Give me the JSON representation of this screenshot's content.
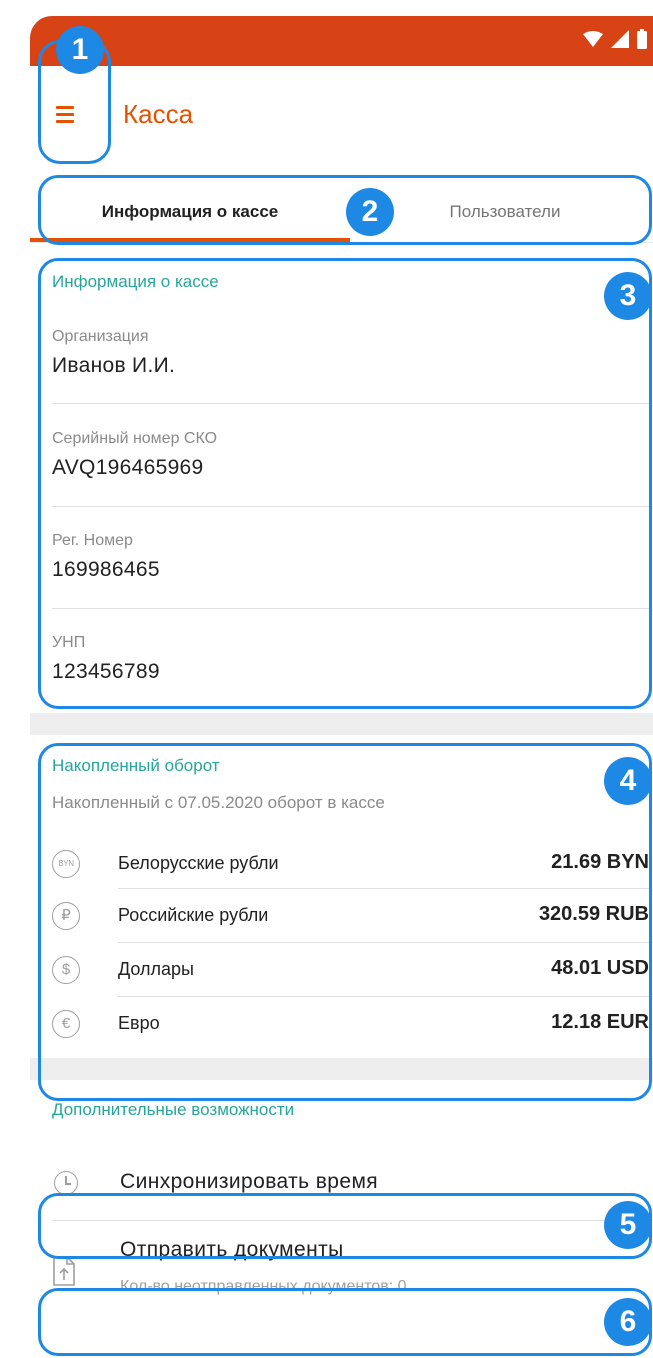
{
  "app_bar": {
    "title": "Касса"
  },
  "tabs": [
    {
      "label": "Информация о кассе",
      "active": true
    },
    {
      "label": "Пользователи",
      "active": false
    }
  ],
  "info": {
    "section_title": "Информация о кассе",
    "fields": [
      {
        "label": "Организация",
        "value": "Иванов И.И."
      },
      {
        "label": "Серийный номер СКО",
        "value": "AVQ196465969"
      },
      {
        "label": "Рег. Номер",
        "value": "169986465"
      },
      {
        "label": "УНП",
        "value": "123456789"
      }
    ]
  },
  "turnover": {
    "section_title": "Накопленный оборот",
    "subtitle": "Накопленный с 07.05.2020 оборот в кассе",
    "rows": [
      {
        "icon_text": "BYN",
        "icon": "byn-icon",
        "name": "Белорусские рубли",
        "value": "21.69 BYN"
      },
      {
        "icon_text": "₽",
        "icon": "ruble-icon",
        "name": "Российские рубли",
        "value": "320.59 RUB"
      },
      {
        "icon_text": "$",
        "icon": "dollar-icon",
        "name": "Доллары",
        "value": "48.01 USD"
      },
      {
        "icon_text": "€",
        "icon": "euro-icon",
        "name": "Евро",
        "value": "12.18 EUR"
      }
    ]
  },
  "extra": {
    "section_title": "Дополнительные возможности",
    "sync": {
      "label": "Синхронизировать время",
      "icon": "clock-icon"
    },
    "send": {
      "label": "Отправить документы",
      "sublabel": "Кол-во неотправленных документов: 0",
      "icon": "upload-document-icon"
    }
  },
  "badges": [
    "1",
    "2",
    "3",
    "4",
    "5",
    "6"
  ],
  "colors": {
    "status_bar": "#d84315",
    "accent": "#e65100",
    "section_title": "#26a69a",
    "annotation": "#1e88e5"
  }
}
